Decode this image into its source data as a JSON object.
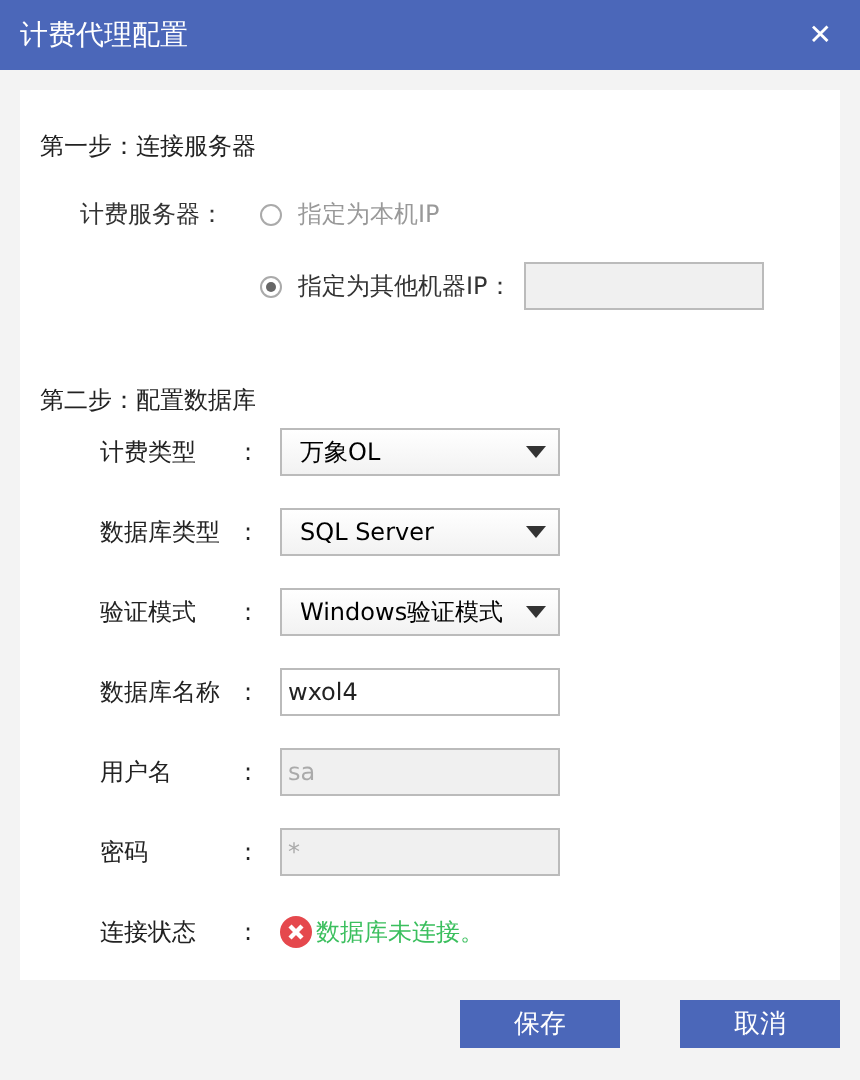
{
  "window": {
    "title": "计费代理配置",
    "close": "✕"
  },
  "step1": {
    "heading": "第一步：连接服务器",
    "label": "计费服务器：",
    "options": [
      {
        "label": "指定为本机IP",
        "selected": false
      },
      {
        "label": "指定为其他机器IP：",
        "selected": true,
        "has_field": true
      }
    ]
  },
  "step2": {
    "heading": "第二步：配置数据库",
    "fields": [
      {
        "label": "计费类型",
        "colon": ":",
        "kind": "select",
        "value": "万象OL"
      },
      {
        "label": "数据库类型",
        "colon": ":",
        "kind": "select",
        "value": "SQL Server"
      },
      {
        "label": "验证模式",
        "colon": ":",
        "kind": "select",
        "value": "Windows验证模式"
      },
      {
        "label": "数据库名称",
        "colon": ":",
        "kind": "text",
        "value": "wxol4",
        "disabled": false
      },
      {
        "label": "用户名",
        "colon": ":",
        "kind": "text",
        "value": "sa",
        "disabled": true
      },
      {
        "label": "密码",
        "colon": ":",
        "kind": "text",
        "value": "*",
        "disabled": true
      },
      {
        "label": "连接状态",
        "colon": ":",
        "kind": "status",
        "value": "数据库未连接。",
        "ok": false
      }
    ]
  },
  "buttons": [
    "保存",
    "取消"
  ]
}
